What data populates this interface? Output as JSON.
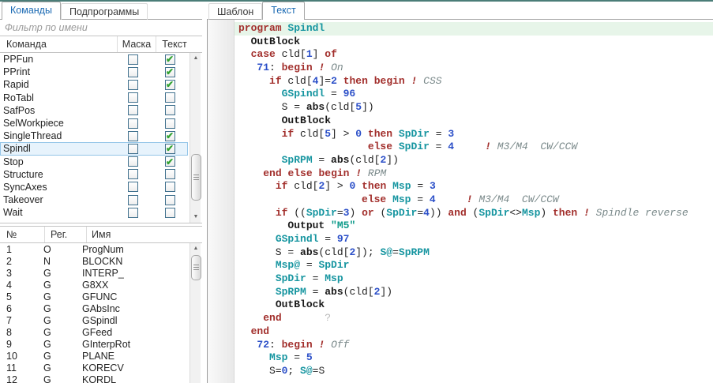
{
  "colors": {
    "accent": "#4b7d78",
    "tab_active": "#1b6ab3",
    "sel_bg": "#e7f3fc",
    "sel_border": "#94c5e8",
    "check": "#31a231",
    "hl_line": "#e7f5e9",
    "kw": "#a22f2c",
    "id": "#1695a0",
    "num": "#2b4fc8",
    "cm": "#7b8a8b",
    "str": "#0e9a8a"
  },
  "left": {
    "tabs": [
      {
        "label": "Команды"
      },
      {
        "label": "Подпрограммы"
      }
    ],
    "filter": {
      "placeholder": "Фильтр по имени"
    },
    "commands_table": {
      "columns": [
        "Команда",
        "Маска",
        "Текст"
      ],
      "selected": "Spindl",
      "rows": [
        {
          "name": "PPFun",
          "mask": false,
          "text": true
        },
        {
          "name": "PPrint",
          "mask": false,
          "text": true
        },
        {
          "name": "Rapid",
          "mask": false,
          "text": true
        },
        {
          "name": "RoTabl",
          "mask": false,
          "text": false
        },
        {
          "name": "SafPos",
          "mask": false,
          "text": false
        },
        {
          "name": "SelWorkpiece",
          "mask": false,
          "text": false
        },
        {
          "name": "SingleThread",
          "mask": false,
          "text": true
        },
        {
          "name": "Spindl",
          "mask": false,
          "text": true
        },
        {
          "name": "Stop",
          "mask": false,
          "text": true
        },
        {
          "name": "Structure",
          "mask": false,
          "text": false
        },
        {
          "name": "SyncAxes",
          "mask": false,
          "text": false
        },
        {
          "name": "Takeover",
          "mask": false,
          "text": false
        },
        {
          "name": "Wait",
          "mask": false,
          "text": false
        }
      ]
    },
    "registers_table": {
      "columns": [
        "№",
        "Рег.",
        "Имя"
      ],
      "rows": [
        [
          "1",
          "O",
          "ProgNum"
        ],
        [
          "2",
          "N",
          "BLOCKN"
        ],
        [
          "3",
          "G",
          "INTERP_"
        ],
        [
          "4",
          "G",
          "G8XX"
        ],
        [
          "5",
          "G",
          "GFUNC"
        ],
        [
          "6",
          "G",
          "GAbsInc"
        ],
        [
          "7",
          "G",
          "GSpindl"
        ],
        [
          "8",
          "G",
          "GFeed"
        ],
        [
          "9",
          "G",
          "GInterpRot"
        ],
        [
          "10",
          "G",
          "PLANE"
        ],
        [
          "11",
          "G",
          "KORECV"
        ],
        [
          "12",
          "G",
          "KORDL"
        ]
      ]
    }
  },
  "right": {
    "tabs": [
      {
        "label": "Шаблон"
      },
      {
        "label": "Текст"
      }
    ],
    "code": {
      "lines": [
        {
          "hl": true,
          "t": [
            [
              "kw",
              "program"
            ],
            [
              "pl",
              " "
            ],
            [
              "id",
              "Spindl"
            ]
          ]
        },
        {
          "t": [
            [
              "pl",
              "  "
            ],
            [
              "fn",
              "OutBlock"
            ]
          ]
        },
        {
          "t": [
            [
              "pl",
              "  "
            ],
            [
              "kw",
              "case"
            ],
            [
              "pl",
              " cld["
            ],
            [
              "num",
              "1"
            ],
            [
              "pl",
              "] "
            ],
            [
              "kw",
              "of"
            ]
          ]
        },
        {
          "t": [
            [
              "pl",
              "   "
            ],
            [
              "num",
              "71"
            ],
            [
              "pl",
              ": "
            ],
            [
              "kw",
              "begin"
            ],
            [
              "pl",
              " "
            ],
            [
              "bang",
              "!"
            ],
            [
              "cm",
              " On"
            ]
          ]
        },
        {
          "t": [
            [
              "pl",
              "     "
            ],
            [
              "kw",
              "if"
            ],
            [
              "pl",
              " cld["
            ],
            [
              "num",
              "4"
            ],
            [
              "pl",
              "]="
            ],
            [
              "num",
              "2"
            ],
            [
              "pl",
              " "
            ],
            [
              "kw",
              "then"
            ],
            [
              "pl",
              " "
            ],
            [
              "kw",
              "begin"
            ],
            [
              "pl",
              " "
            ],
            [
              "bang",
              "!"
            ],
            [
              "cm",
              " CSS"
            ]
          ]
        },
        {
          "t": [
            [
              "pl",
              "       "
            ],
            [
              "id",
              "GSpindl"
            ],
            [
              "pl",
              " = "
            ],
            [
              "num",
              "96"
            ]
          ]
        },
        {
          "t": [
            [
              "pl",
              "       S = "
            ],
            [
              "fn",
              "abs"
            ],
            [
              "pl",
              "(cld["
            ],
            [
              "num",
              "5"
            ],
            [
              "pl",
              "])"
            ]
          ]
        },
        {
          "t": [
            [
              "pl",
              "       "
            ],
            [
              "fn",
              "OutBlock"
            ]
          ]
        },
        {
          "t": [
            [
              "pl",
              "       "
            ],
            [
              "kw",
              "if"
            ],
            [
              "pl",
              " cld["
            ],
            [
              "num",
              "5"
            ],
            [
              "pl",
              "] > "
            ],
            [
              "num",
              "0"
            ],
            [
              "pl",
              " "
            ],
            [
              "kw",
              "then"
            ],
            [
              "pl",
              " "
            ],
            [
              "id",
              "SpDir"
            ],
            [
              "pl",
              " = "
            ],
            [
              "num",
              "3"
            ]
          ]
        },
        {
          "t": [
            [
              "pl",
              "                     "
            ],
            [
              "kw",
              "else"
            ],
            [
              "pl",
              " "
            ],
            [
              "id",
              "SpDir"
            ],
            [
              "pl",
              " = "
            ],
            [
              "num",
              "4"
            ],
            [
              "pl",
              "     "
            ],
            [
              "bang",
              "!"
            ],
            [
              "cm",
              " M3/M4  CW/CCW"
            ]
          ]
        },
        {
          "t": [
            [
              "pl",
              "       "
            ],
            [
              "id",
              "SpRPM"
            ],
            [
              "pl",
              " = "
            ],
            [
              "fn",
              "abs"
            ],
            [
              "pl",
              "(cld["
            ],
            [
              "num",
              "2"
            ],
            [
              "pl",
              "])"
            ]
          ]
        },
        {
          "t": [
            [
              "pl",
              "    "
            ],
            [
              "kw",
              "end"
            ],
            [
              "pl",
              " "
            ],
            [
              "kw",
              "else"
            ],
            [
              "pl",
              " "
            ],
            [
              "kw",
              "begin"
            ],
            [
              "pl",
              " "
            ],
            [
              "bang",
              "!"
            ],
            [
              "cm",
              " RPM"
            ]
          ]
        },
        {
          "t": [
            [
              "pl",
              "      "
            ],
            [
              "kw",
              "if"
            ],
            [
              "pl",
              " cld["
            ],
            [
              "num",
              "2"
            ],
            [
              "pl",
              "] > "
            ],
            [
              "num",
              "0"
            ],
            [
              "pl",
              " "
            ],
            [
              "kw",
              "then"
            ],
            [
              "pl",
              " "
            ],
            [
              "id",
              "Msp"
            ],
            [
              "pl",
              " = "
            ],
            [
              "num",
              "3"
            ]
          ]
        },
        {
          "t": [
            [
              "pl",
              "                    "
            ],
            [
              "kw",
              "else"
            ],
            [
              "pl",
              " "
            ],
            [
              "id",
              "Msp"
            ],
            [
              "pl",
              " = "
            ],
            [
              "num",
              "4"
            ],
            [
              "pl",
              "     "
            ],
            [
              "bang",
              "!"
            ],
            [
              "cm",
              " M3/M4  CW/CCW"
            ]
          ]
        },
        {
          "t": [
            [
              "pl",
              "      "
            ],
            [
              "kw",
              "if"
            ],
            [
              "pl",
              " (("
            ],
            [
              "id",
              "SpDir"
            ],
            [
              "pl",
              "="
            ],
            [
              "num",
              "3"
            ],
            [
              "pl",
              ") "
            ],
            [
              "kw",
              "or"
            ],
            [
              "pl",
              " ("
            ],
            [
              "id",
              "SpDir"
            ],
            [
              "pl",
              "="
            ],
            [
              "num",
              "4"
            ],
            [
              "pl",
              ")) "
            ],
            [
              "kw",
              "and"
            ],
            [
              "pl",
              " ("
            ],
            [
              "id",
              "SpDir"
            ],
            [
              "pl",
              "<>"
            ],
            [
              "id",
              "Msp"
            ],
            [
              "pl",
              ") "
            ],
            [
              "kw",
              "then"
            ],
            [
              "pl",
              " "
            ],
            [
              "bang",
              "!"
            ],
            [
              "cm",
              " Spindle reverse"
            ]
          ]
        },
        {
          "t": [
            [
              "pl",
              "        "
            ],
            [
              "fn",
              "Output"
            ],
            [
              "pl",
              " "
            ],
            [
              "str",
              "\"M5\""
            ]
          ]
        },
        {
          "t": [
            [
              "pl",
              "      "
            ],
            [
              "id",
              "GSpindl"
            ],
            [
              "pl",
              " = "
            ],
            [
              "num",
              "97"
            ]
          ]
        },
        {
          "t": [
            [
              "pl",
              "      S = "
            ],
            [
              "fn",
              "abs"
            ],
            [
              "pl",
              "(cld["
            ],
            [
              "num",
              "2"
            ],
            [
              "pl",
              "]); "
            ],
            [
              "id",
              "S@"
            ],
            [
              "pl",
              "="
            ],
            [
              "id",
              "SpRPM"
            ]
          ]
        },
        {
          "t": [
            [
              "pl",
              "      "
            ],
            [
              "id",
              "Msp@"
            ],
            [
              "pl",
              " = "
            ],
            [
              "id",
              "SpDir"
            ]
          ]
        },
        {
          "t": [
            [
              "pl",
              "      "
            ],
            [
              "id",
              "SpDir"
            ],
            [
              "pl",
              " = "
            ],
            [
              "id",
              "Msp"
            ]
          ]
        },
        {
          "t": [
            [
              "pl",
              "      "
            ],
            [
              "id",
              "SpRPM"
            ],
            [
              "pl",
              " = "
            ],
            [
              "fn",
              "abs"
            ],
            [
              "pl",
              "(cld["
            ],
            [
              "num",
              "2"
            ],
            [
              "pl",
              "])"
            ]
          ]
        },
        {
          "t": [
            [
              "pl",
              "      "
            ],
            [
              "fn",
              "OutBlock"
            ]
          ]
        },
        {
          "t": [
            [
              "pl",
              "    "
            ],
            [
              "kw",
              "end"
            ],
            [
              "pl",
              "       "
            ],
            [
              "q",
              "?"
            ]
          ]
        },
        {
          "t": [
            [
              "pl",
              "  "
            ],
            [
              "kw",
              "end"
            ]
          ]
        },
        {
          "t": [
            [
              "pl",
              "   "
            ],
            [
              "num",
              "72"
            ],
            [
              "pl",
              ": "
            ],
            [
              "kw",
              "begin"
            ],
            [
              "pl",
              " "
            ],
            [
              "bang",
              "!"
            ],
            [
              "cm",
              " Off"
            ]
          ]
        },
        {
          "t": [
            [
              "pl",
              "     "
            ],
            [
              "id",
              "Msp"
            ],
            [
              "pl",
              " = "
            ],
            [
              "num",
              "5"
            ]
          ]
        },
        {
          "t": [
            [
              "pl",
              "     S="
            ],
            [
              "num",
              "0"
            ],
            [
              "pl",
              "; "
            ],
            [
              "id",
              "S@"
            ],
            [
              "pl",
              "=S"
            ]
          ]
        }
      ]
    }
  }
}
